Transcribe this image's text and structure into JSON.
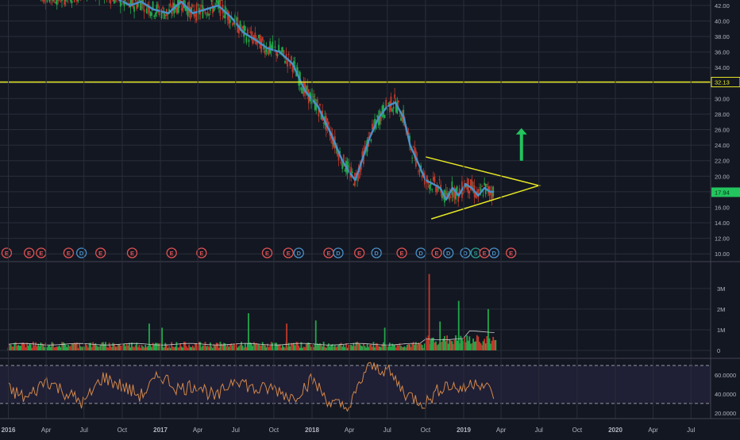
{
  "chart_data": [
    {
      "type": "line",
      "title": "",
      "xlabel": "",
      "ylabel": "",
      "x_ticks": [
        "2016",
        "Apr",
        "Jul",
        "Oct",
        "2017",
        "Apr",
        "Jul",
        "Oct",
        "2018",
        "Apr",
        "Jul",
        "Oct",
        "2019",
        "Apr",
        "Jul",
        "Oct",
        "2020",
        "Apr",
        "Jul"
      ],
      "y_ticks": [
        "42.00",
        "40.00",
        "38.00",
        "36.00",
        "34.00",
        "32.00",
        "30.00",
        "28.00",
        "26.00",
        "24.00",
        "22.00",
        "20.00",
        "18.00",
        "16.00",
        "14.00",
        "12.00",
        "10.00"
      ],
      "ylim": [
        9.0,
        42.5
      ],
      "xlim": [
        "2015-12-31",
        "2020-09-15"
      ],
      "series": [
        {
          "color": "#4a90c8",
          "x": [
            "2016-03-15",
            "2016-05-01",
            "2016-06-15",
            "2016-08-01",
            "2016-09-15",
            "2016-10-20",
            "2016-11-15",
            "2016-12-15",
            "2017-01-20",
            "2017-02-20",
            "2017-03-20",
            "2017-04-20",
            "2017-05-20",
            "2017-06-20",
            "2017-07-20",
            "2017-08-20",
            "2017-09-15",
            "2017-10-15",
            "2017-11-15",
            "2017-12-15",
            "2018-01-15",
            "2018-02-15",
            "2018-03-15",
            "2018-04-01",
            "2018-04-15",
            "2018-05-01",
            "2018-05-20",
            "2018-06-10",
            "2018-07-01",
            "2018-07-20",
            "2018-08-10",
            "2018-08-25",
            "2018-09-15",
            "2018-10-01",
            "2018-10-20",
            "2018-11-05",
            "2018-11-20",
            "2018-12-05",
            "2018-12-20",
            "2019-01-05",
            "2019-01-20",
            "2019-02-05",
            "2019-02-20",
            "2019-03-05",
            "2019-03-15"
          ],
          "y": [
            43.5,
            43.0,
            43.5,
            44.0,
            43.0,
            42.0,
            42.5,
            41.5,
            41.0,
            42.5,
            41.0,
            41.5,
            42.0,
            40.5,
            38.5,
            37.5,
            36.5,
            36.0,
            34.5,
            31.0,
            29.0,
            25.5,
            22.0,
            20.5,
            19.5,
            22.0,
            25.0,
            27.5,
            29.0,
            29.5,
            27.5,
            24.0,
            21.5,
            19.5,
            19.0,
            18.5,
            17.0,
            18.5,
            17.5,
            19.0,
            18.5,
            17.5,
            18.5,
            18.0,
            18.0
          ]
        }
      ],
      "reference_lines": [
        {
          "type": "horizontal",
          "value": 32.13,
          "label": "32.13",
          "color": "#e8e823"
        }
      ],
      "last_value": {
        "value": 17.94,
        "label": "17.94",
        "color": "#22c55e"
      },
      "drawings": [
        {
          "type": "triangle",
          "color": "#e8e823",
          "points": [
            [
              "2018-10-01",
              22.5
            ],
            [
              "2019-07-01",
              18.8
            ],
            [
              "2018-10-15",
              14.5
            ]
          ]
        }
      ],
      "annotation": {
        "type": "arrow-up",
        "color": "#22c55e"
      },
      "event_markers": [
        {
          "x": "2015-12-28",
          "label": "E",
          "color": "#e05252"
        },
        {
          "x": "2016-02-20",
          "label": "E",
          "color": "#e05252"
        },
        {
          "x": "2016-03-20",
          "label": "E",
          "color": "#e05252"
        },
        {
          "x": "2016-05-25",
          "label": "E",
          "color": "#e05252"
        },
        {
          "x": "2016-06-25",
          "label": "D",
          "color": "#4a90c8"
        },
        {
          "x": "2016-08-10",
          "label": "E",
          "color": "#e05252"
        },
        {
          "x": "2016-10-25",
          "label": "E",
          "color": "#e05252"
        },
        {
          "x": "2017-01-28",
          "label": "E",
          "color": "#e05252"
        },
        {
          "x": "2017-04-10",
          "label": "E",
          "color": "#e05252"
        },
        {
          "x": "2017-09-15",
          "label": "E",
          "color": "#e05252"
        },
        {
          "x": "2017-11-05",
          "label": "E",
          "color": "#e05252"
        },
        {
          "x": "2017-11-30",
          "label": "D",
          "color": "#4a90c8"
        },
        {
          "x": "2018-02-10",
          "label": "E",
          "color": "#e05252"
        },
        {
          "x": "2018-03-05",
          "label": "D",
          "color": "#4a90c8"
        },
        {
          "x": "2018-04-25",
          "label": "E",
          "color": "#e05252"
        },
        {
          "x": "2018-06-05",
          "label": "D",
          "color": "#4a90c8"
        },
        {
          "x": "2018-08-05",
          "label": "E",
          "color": "#e05252"
        },
        {
          "x": "2018-09-20",
          "label": "D",
          "color": "#4a90c8"
        },
        {
          "x": "2018-10-28",
          "label": "E",
          "color": "#e05252"
        },
        {
          "x": "2018-11-25",
          "label": "D",
          "color": "#4a90c8"
        },
        {
          "x": "2019-01-05",
          "label": "D",
          "color": "#4a90c8"
        },
        {
          "x": "2019-01-30",
          "label": "S",
          "color": "#2a9d8f"
        },
        {
          "x": "2019-02-20",
          "label": "E",
          "color": "#e05252"
        },
        {
          "x": "2019-03-15",
          "label": "D",
          "color": "#4a90c8"
        },
        {
          "x": "2019-04-25",
          "label": "E",
          "color": "#e05252"
        }
      ],
      "grid": true,
      "colors": {
        "background": "#131722",
        "grid": "#2a2e39",
        "text": "#b2b5be",
        "candle_up": "#22a84a",
        "candle_down": "#c0392b"
      }
    },
    {
      "type": "bar",
      "title": "",
      "y_ticks": [
        "3M",
        "2M",
        "1M",
        "0"
      ],
      "ylim": [
        0,
        3800000
      ],
      "description_free": true,
      "spikes": [
        {
          "x": "2018-10-10",
          "value": 3700000,
          "color": "#c0392b"
        },
        {
          "x": "2018-11-05",
          "value": 1400000,
          "color": "#22a84a"
        },
        {
          "x": "2018-12-20",
          "value": 2400000,
          "color": "#22a84a"
        },
        {
          "x": "2019-03-01",
          "value": 2000000,
          "color": "#22a84a"
        },
        {
          "x": "2016-12-05",
          "value": 1300000,
          "color": "#22a84a"
        },
        {
          "x": "2017-01-05",
          "value": 1100000,
          "color": "#22a84a"
        },
        {
          "x": "2017-08-01",
          "value": 1800000,
          "color": "#22a84a"
        },
        {
          "x": "2017-11-01",
          "value": 1300000,
          "color": "#c0392b"
        },
        {
          "x": "2018-01-10",
          "value": 1450000,
          "color": "#22a84a"
        },
        {
          "x": "2018-06-25",
          "value": 1100000,
          "color": "#22a84a"
        }
      ],
      "colors": {
        "up": "#22a84a",
        "down": "#c0392b",
        "average": "#d0d0d0"
      }
    },
    {
      "type": "line",
      "title": "",
      "y_ticks": [
        "60.0000",
        "40.0000",
        "20.0000"
      ],
      "ylim": [
        14,
        75
      ],
      "reference_lines": [
        {
          "value": 70,
          "style": "dashed"
        },
        {
          "value": 30,
          "style": "dashed"
        }
      ],
      "band": [
        30,
        70
      ],
      "series": [
        {
          "color": "#d2874a",
          "x": [
            "2015-12-31",
            "2016-02-15",
            "2016-04-01",
            "2016-05-15",
            "2016-07-01",
            "2016-08-15",
            "2016-10-01",
            "2016-11-15",
            "2017-01-01",
            "2017-02-15",
            "2017-04-01",
            "2017-05-15",
            "2017-07-01",
            "2017-08-15",
            "2017-10-01",
            "2017-11-15",
            "2018-01-01",
            "2018-02-15",
            "2018-04-01",
            "2018-05-15",
            "2018-07-01",
            "2018-08-15",
            "2018-10-01",
            "2018-11-15",
            "2019-01-01",
            "2019-02-01",
            "2019-03-15"
          ],
          "y": [
            45,
            35,
            55,
            42,
            30,
            58,
            48,
            38,
            60,
            45,
            50,
            35,
            58,
            44,
            46,
            36,
            55,
            30,
            25,
            70,
            65,
            40,
            30,
            50,
            45,
            55,
            40
          ]
        }
      ]
    }
  ]
}
